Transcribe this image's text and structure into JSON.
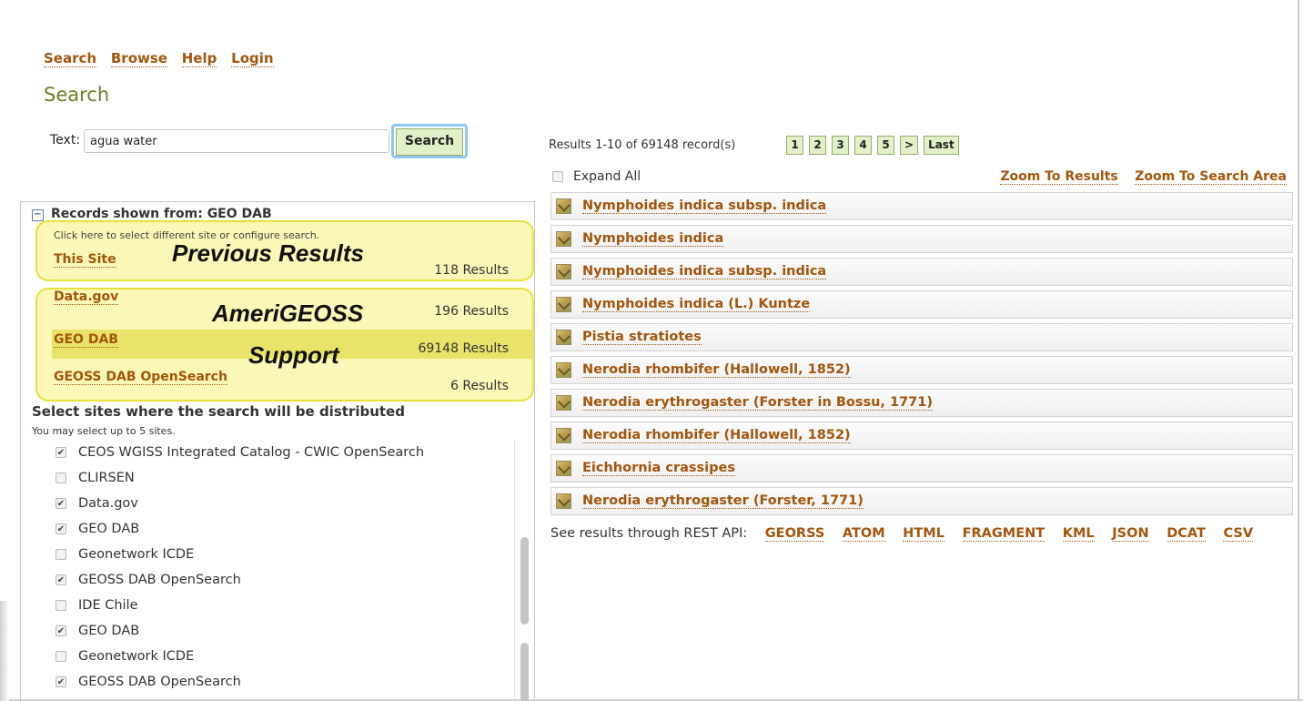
{
  "nav": {
    "items": [
      "Search",
      "Browse",
      "Help",
      "Login"
    ]
  },
  "page_title": "Search",
  "search": {
    "label": "Text:",
    "value": "agua water",
    "button": "Search"
  },
  "records": {
    "header": "Records shown from: GEO DAB",
    "hint": "Click here to select different site or configure search.",
    "sites": [
      {
        "name": "This Site",
        "count": "118 Results"
      },
      {
        "name": "Data.gov",
        "count": "196 Results"
      },
      {
        "name": "GEO DAB",
        "count": "69148 Results"
      },
      {
        "name": "GEOSS DAB OpenSearch",
        "count": "6 Results"
      }
    ]
  },
  "annotations": {
    "previous": "Previous Results",
    "ameri_line1": "AmeriGEOSS",
    "ameri_line2": "Support"
  },
  "distribute": {
    "title": "Select sites where the search will be distributed",
    "subtitle": "You may select up to 5 sites.",
    "sites": [
      {
        "label": "CEOS WGISS Integrated Catalog - CWIC OpenSearch",
        "checked": true
      },
      {
        "label": "CLIRSEN",
        "checked": false
      },
      {
        "label": "Data.gov",
        "checked": true
      },
      {
        "label": "GEO DAB",
        "checked": true
      },
      {
        "label": "Geonetwork ICDE",
        "checked": false
      },
      {
        "label": "GEOSS DAB OpenSearch",
        "checked": true
      },
      {
        "label": "IDE Chile",
        "checked": false
      },
      {
        "label": "GEO DAB",
        "checked": true
      },
      {
        "label": "Geonetwork ICDE",
        "checked": false
      },
      {
        "label": "GEOSS DAB OpenSearch",
        "checked": true
      }
    ]
  },
  "results": {
    "summary": "Results 1-10 of 69148 record(s)",
    "pages": [
      "1",
      "2",
      "3",
      "4",
      "5",
      ">",
      "Last"
    ],
    "expand_all": "Expand All",
    "zoom_results": "Zoom To Results",
    "zoom_search_area": "Zoom To Search Area",
    "items": [
      "Nymphoides indica subsp. indica",
      "Nymphoides indica",
      "Nymphoides indica subsp. indica",
      "Nymphoides indica (L.) Kuntze",
      "Pistia stratiotes",
      "Nerodia rhombifer (Hallowell, 1852)",
      "Nerodia erythrogaster (Forster in Bossu, 1771)",
      "Nerodia rhombifer (Hallowell, 1852)",
      "Eichhornia crassipes",
      "Nerodia erythrogaster (Forster, 1771)"
    ],
    "rest_label": "See results through REST API:",
    "rest_formats": [
      "GEORSS",
      "ATOM",
      "HTML",
      "FRAGMENT",
      "KML",
      "JSON",
      "DCAT",
      "CSV"
    ]
  },
  "colors": {
    "link": "#a3560c",
    "title": "#6d7c2a",
    "highlight": "#fbf7b6",
    "highlight_border": "#e8df3a",
    "button_bg": "#e1f0c8"
  }
}
